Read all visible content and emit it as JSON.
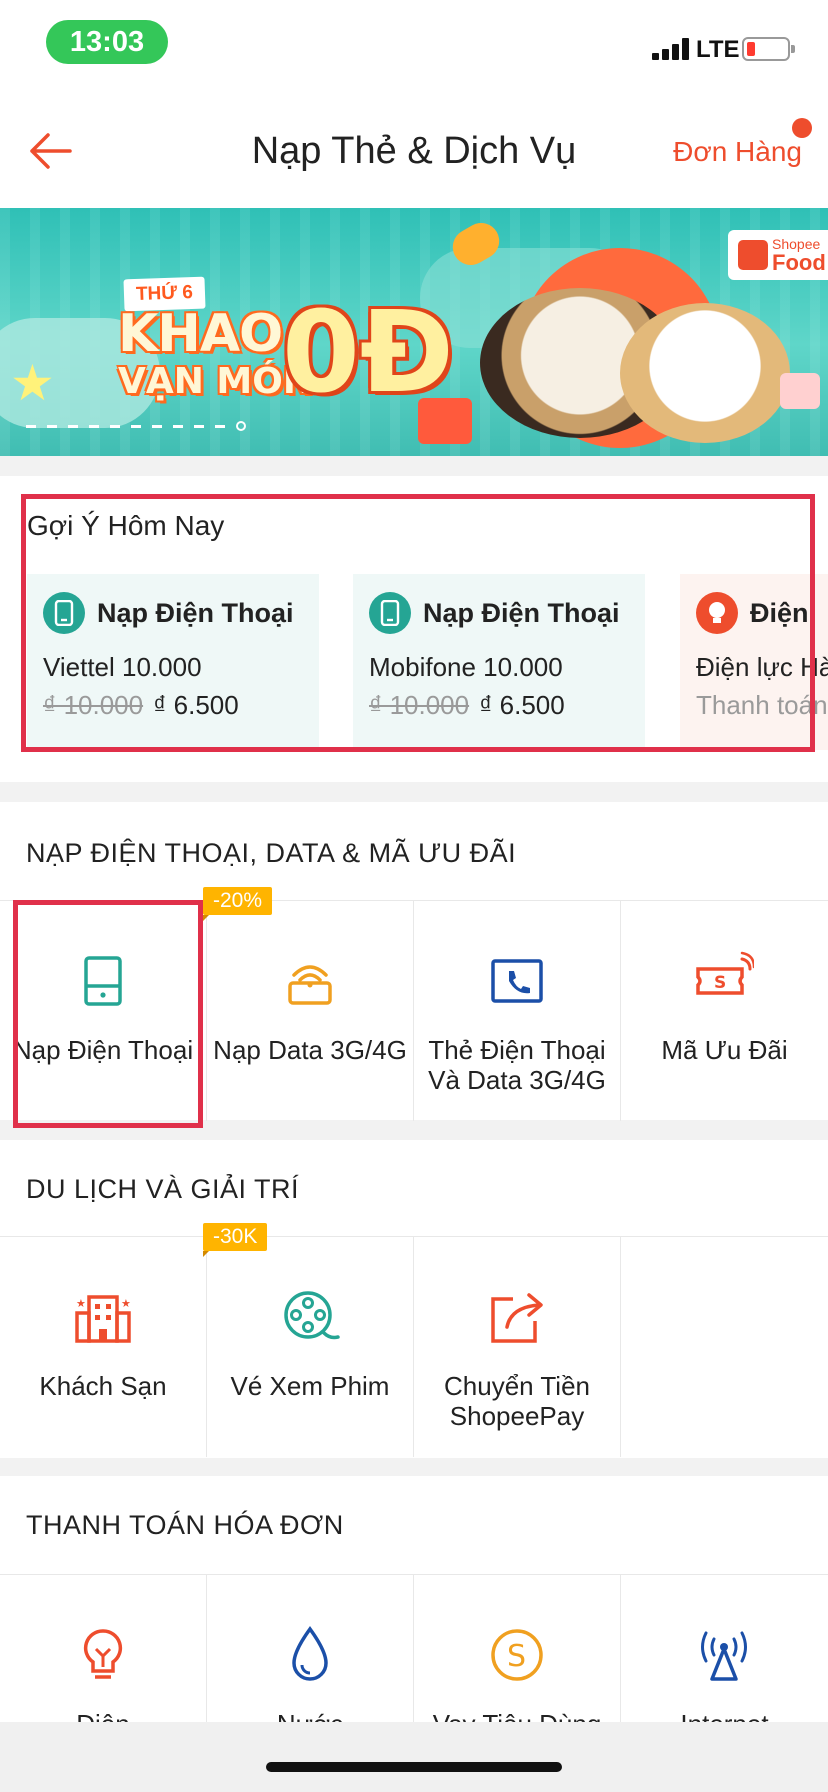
{
  "status_bar": {
    "time": "13:03",
    "network": "LTE"
  },
  "header": {
    "title": "Nạp Thẻ & Dịch Vụ",
    "orders_label": "Đơn Hàng"
  },
  "banner": {
    "day_tag": "THỨ 6",
    "line1": "KHAO",
    "line2": "VẠN MÓN",
    "big": "0Đ",
    "brand_top": "Shopee",
    "brand_bottom": "Food",
    "slide_count": 11,
    "active_slide": 11
  },
  "suggestions": {
    "title": "Gợi Ý Hôm Nay",
    "items": [
      {
        "name": "Nạp Điện Thoại",
        "detail": "Viettel 10.000",
        "old_price": "₫ 10.000",
        "new_price": "₫ 6.500",
        "icon": "phone-icon"
      },
      {
        "name": "Nạp Điện Thoại",
        "detail": "Mobifone 10.000",
        "old_price": "₫ 10.000",
        "new_price": "₫ 6.500",
        "icon": "phone-icon"
      },
      {
        "name": "Điện",
        "detail": "Điện lực Hà",
        "note": "Thanh toán",
        "icon": "bulb-icon"
      }
    ]
  },
  "sections": {
    "phone": {
      "title": "NẠP ĐIỆN THOẠI, DATA & MÃ ƯU ĐÃI",
      "items": [
        {
          "label": "Nạp Điện Thoại",
          "icon": "phone-icon"
        },
        {
          "label": "Nạp Data 3G/4G",
          "icon": "wifi-icon",
          "badge": "-20%"
        },
        {
          "label": "Thẻ Điện Thoại\nVà Data 3G/4G",
          "icon": "phone-card-icon"
        },
        {
          "label": "Mã Ưu Đãi",
          "icon": "voucher-icon"
        }
      ]
    },
    "travel": {
      "title": "DU LỊCH VÀ GIẢI TRÍ",
      "items": [
        {
          "label": "Khách Sạn",
          "icon": "hotel-icon"
        },
        {
          "label": "Vé Xem Phim",
          "icon": "film-reel-icon",
          "badge": "-30K"
        },
        {
          "label": "Chuyển Tiền\nShopeePay",
          "icon": "transfer-icon"
        }
      ]
    },
    "bills": {
      "title": "THANH TOÁN HÓA ĐƠN",
      "items": [
        {
          "label": "Điện",
          "icon": "bulb-icon"
        },
        {
          "label": "Nước",
          "icon": "water-drop-icon"
        },
        {
          "label": "Vay Tiêu Dùng",
          "icon": "coin-icon"
        },
        {
          "label": "Internet",
          "icon": "antenna-icon"
        }
      ]
    }
  },
  "colors": {
    "accent": "#ee4d2d",
    "teal": "#25a594",
    "orange": "#f0a020",
    "blue": "#1b4fa8",
    "highlight": "#e0304a",
    "badge": "#ffb400"
  }
}
